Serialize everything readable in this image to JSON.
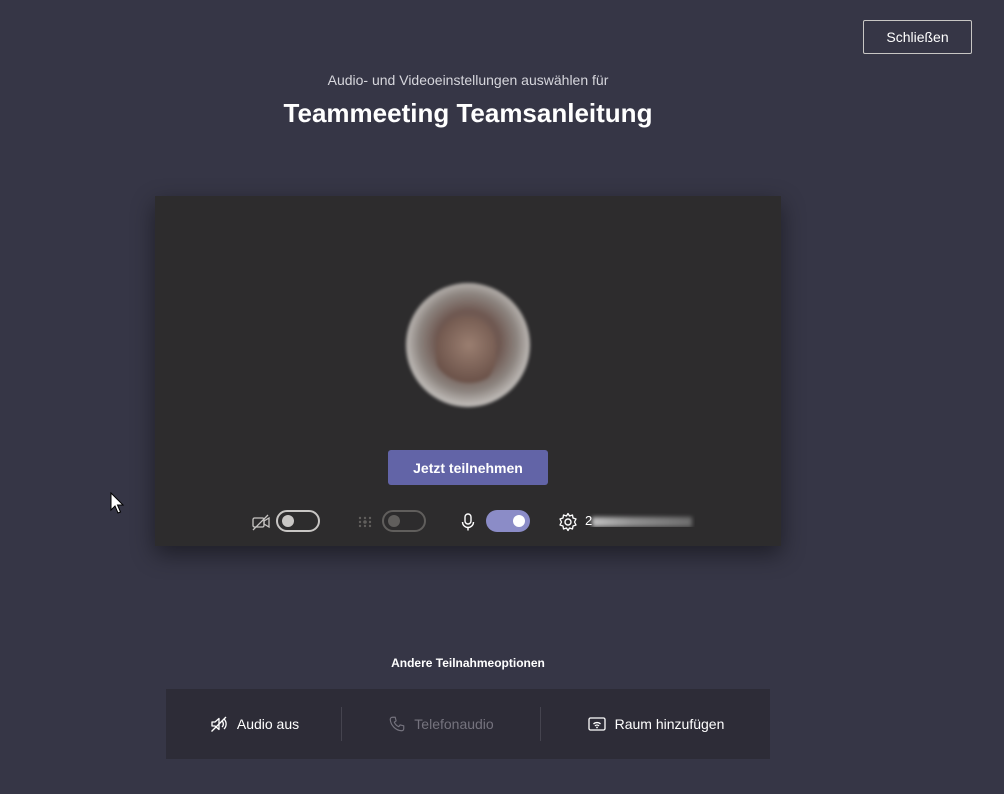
{
  "header": {
    "close_label": "Schließen",
    "subtitle": "Audio- und Videoeinstellungen auswählen für",
    "title": "Teammeeting Teamsanleitung"
  },
  "preview": {
    "join_label": "Jetzt teilnehmen",
    "controls": {
      "camera_toggle": "off",
      "blur_toggle": "disabled",
      "mic_toggle": "on",
      "device_name_visible": "2"
    }
  },
  "other_options": {
    "label": "Andere Teilnahmeoptionen",
    "items": [
      {
        "label": "Audio aus",
        "icon": "speaker-off-icon",
        "enabled": true
      },
      {
        "label": "Telefonaudio",
        "icon": "phone-icon",
        "enabled": false
      },
      {
        "label": "Raum hinzufügen",
        "icon": "cast-room-icon",
        "enabled": true
      }
    ]
  },
  "colors": {
    "background": "#363646",
    "panel": "#2d2c2d",
    "accent": "#6264a7",
    "toggle_on": "#8b8cc7"
  }
}
